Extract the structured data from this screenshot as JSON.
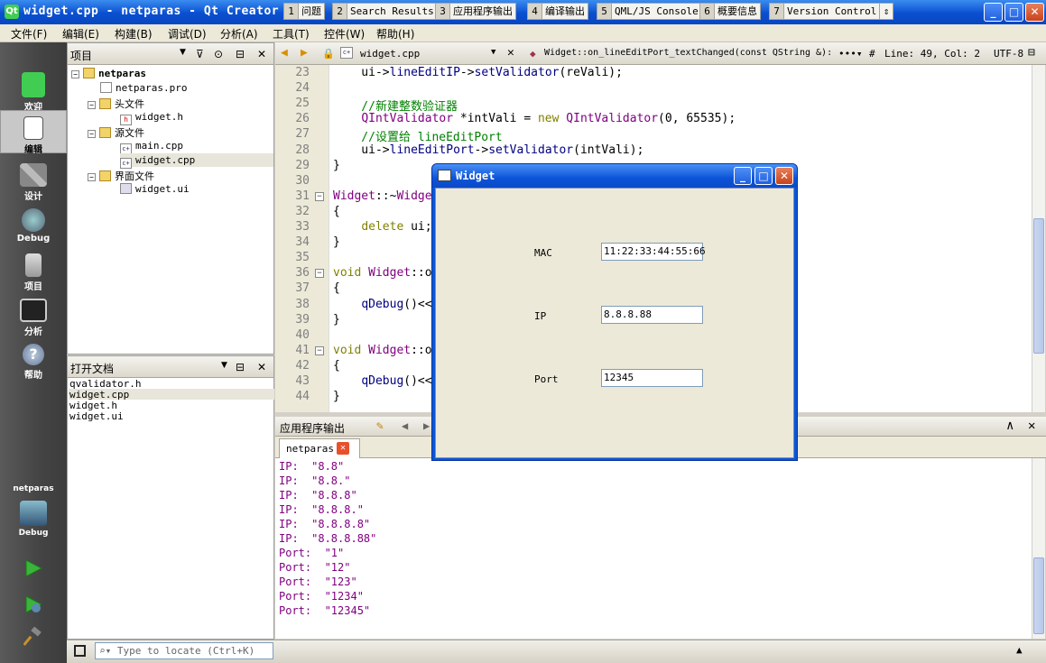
{
  "window": {
    "title": "widget.cpp - netparas - Qt Creator",
    "app_icon": "Qt"
  },
  "menu": [
    "文件(F)",
    "编辑(E)",
    "构建(B)",
    "调试(D)",
    "分析(A)",
    "工具(T)",
    "控件(W)",
    "帮助(H)"
  ],
  "modes": [
    {
      "label": "欢迎",
      "icon": "qt-logo-icon"
    },
    {
      "label": "编辑",
      "icon": "edit-document-icon",
      "active": true
    },
    {
      "label": "设计",
      "icon": "design-pen-icon"
    },
    {
      "label": "Debug",
      "icon": "debug-bug-icon"
    },
    {
      "label": "项目",
      "icon": "projects-icon"
    },
    {
      "label": "分析",
      "icon": "analyze-monitor-icon"
    },
    {
      "label": "帮助",
      "icon": "help-icon"
    }
  ],
  "kit": {
    "project": "netparas",
    "config": "Debug"
  },
  "project_panel": {
    "title": "项目",
    "tree": [
      {
        "label": "netparas",
        "level": 0
      },
      {
        "label": "netparas.pro",
        "level": 1
      },
      {
        "label": "头文件",
        "level": 1
      },
      {
        "label": "widget.h",
        "level": 2
      },
      {
        "label": "源文件",
        "level": 1
      },
      {
        "label": "main.cpp",
        "level": 2
      },
      {
        "label": "widget.cpp",
        "level": 2,
        "selected": true
      },
      {
        "label": "界面文件",
        "level": 1
      },
      {
        "label": "widget.ui",
        "level": 2
      }
    ]
  },
  "open_docs": {
    "title": "打开文档",
    "items": [
      "qvalidator.h",
      "widget.cpp",
      "widget.h",
      "widget.ui"
    ]
  },
  "editor_toolbar": {
    "file": "widget.cpp",
    "symbol": "Widget::on_lineEditPort_textChanged(const QString &):",
    "hash": "#",
    "position": "Line: 49, Col: 2",
    "encoding": "UTF-8"
  },
  "code_lines": [
    {
      "n": "23",
      "t": "    ui->lineEditIP->setValidator(reVali);"
    },
    {
      "n": "24",
      "t": ""
    },
    {
      "n": "25",
      "t": "    //新建整数验证器"
    },
    {
      "n": "26",
      "t": "    QIntValidator *intVali = new QIntValidator(0, 65535);"
    },
    {
      "n": "27",
      "t": "    //设置给 lineEditPort"
    },
    {
      "n": "28",
      "t": "    ui->lineEditPort->setValidator(intVali);"
    },
    {
      "n": "29",
      "t": "}"
    },
    {
      "n": "30",
      "t": ""
    },
    {
      "n": "31",
      "t": "Widget::~Widget()"
    },
    {
      "n": "32",
      "t": "{"
    },
    {
      "n": "33",
      "t": "    delete ui;"
    },
    {
      "n": "34",
      "t": "}"
    },
    {
      "n": "35",
      "t": ""
    },
    {
      "n": "36",
      "t": "void Widget::on_lineEditMAC_textChanged(const QString &arg1)"
    },
    {
      "n": "37",
      "t": "{"
    },
    {
      "n": "38",
      "t": "    qDebug()<<\"MAC: \"<<arg1;"
    },
    {
      "n": "39",
      "t": "}"
    },
    {
      "n": "40",
      "t": ""
    },
    {
      "n": "41",
      "t": "void Widget::on_lineEditIP_textChanged(const QString &arg1)"
    },
    {
      "n": "42",
      "t": "{"
    },
    {
      "n": "43",
      "t": "    qDebug()<<\"IP: \"<<arg1;"
    },
    {
      "n": "44",
      "t": "}"
    }
  ],
  "visible_code_fragments": {
    "l31_tail": "Wid",
    "l33_tail": "delete u",
    "l36_head": "void Widget:",
    "l36_tail": "g1)",
    "l38": "qDebug()",
    "l41_head": "void Widget:",
    "l41_tail": "1)",
    "l43": "qDebug()"
  },
  "output": {
    "title": "应用程序输出",
    "tab": "netparas",
    "lines": [
      "IP:  \"8.8\"",
      "IP:  \"8.8.\"",
      "IP:  \"8.8.8\"",
      "IP:  \"8.8.8.\"",
      "IP:  \"8.8.8.8\"",
      "IP:  \"8.8.8.88\"",
      "Port:  \"1\"",
      "Port:  \"12\"",
      "Port:  \"123\"",
      "Port:  \"1234\"",
      "Port:  \"12345\""
    ]
  },
  "dialog": {
    "title": "Widget",
    "fields": [
      {
        "label": "MAC",
        "value": "11:22:33:44:55:66"
      },
      {
        "label": "IP",
        "value": "8.8.8.88"
      },
      {
        "label": "Port",
        "value": "12345"
      }
    ]
  },
  "statusbar": {
    "locator_placeholder": "Type to locate (Ctrl+K)",
    "tabs": [
      {
        "n": "1",
        "label": "问题"
      },
      {
        "n": "2",
        "label": "Search Results"
      },
      {
        "n": "3",
        "label": "应用程序输出"
      },
      {
        "n": "4",
        "label": "编译输出"
      },
      {
        "n": "5",
        "label": "QML/JS Console"
      },
      {
        "n": "6",
        "label": "概要信息"
      },
      {
        "n": "7",
        "label": "Version Control"
      }
    ]
  }
}
